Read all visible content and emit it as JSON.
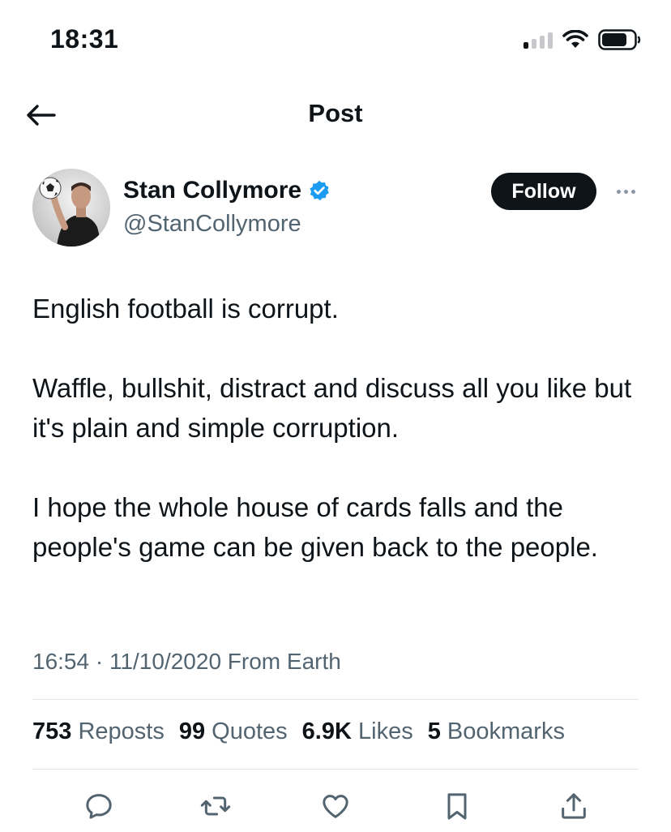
{
  "status_bar": {
    "time": "18:31",
    "icons": [
      "cellular-signal-icon",
      "wifi-icon",
      "battery-icon"
    ]
  },
  "nav": {
    "title": "Post",
    "back_icon": "back-arrow-icon"
  },
  "author": {
    "display_name": "Stan Collymore",
    "handle": "@StanCollymore",
    "verified": true,
    "verified_color": "#1d9bf0",
    "follow_label": "Follow"
  },
  "post": {
    "paragraphs": [
      "English football is corrupt.",
      "Waffle, bullshit, distract and discuss all you like but it's plain and simple corruption.",
      "I hope the whole house of cards falls and the people's game can be given back to the people."
    ],
    "meta": "16:54 · 11/10/2020 From Earth"
  },
  "stats": [
    {
      "count": "753",
      "label": "Reposts"
    },
    {
      "count": "99",
      "label": "Quotes"
    },
    {
      "count": "6.9K",
      "label": "Likes"
    },
    {
      "count": "5",
      "label": "Bookmarks"
    }
  ],
  "actions": [
    "reply-icon",
    "repost-icon",
    "like-icon",
    "bookmark-icon",
    "share-icon"
  ],
  "colors": {
    "text": "#0f1419",
    "secondary": "#536471",
    "accent": "#1d9bf0",
    "divider": "#e1e6ea"
  }
}
